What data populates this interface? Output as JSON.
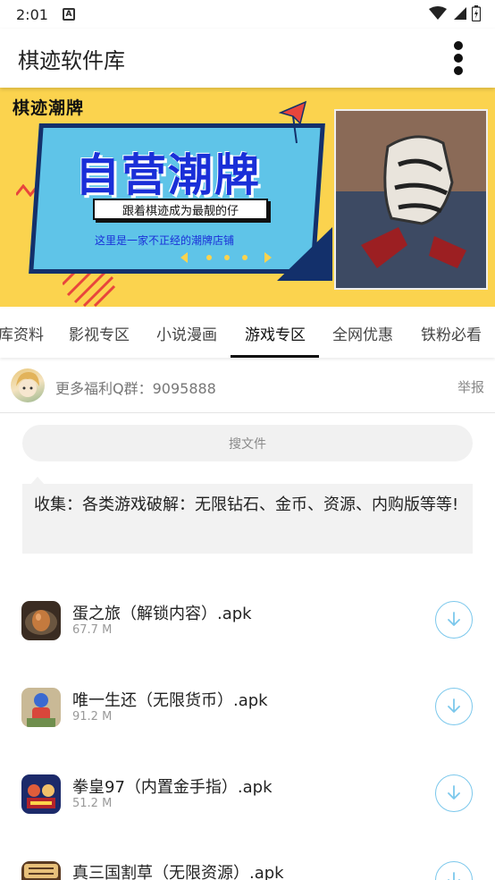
{
  "status_bar": {
    "time": "2:01",
    "notification_icon": "a-icon",
    "icons": [
      "wifi-icon",
      "signal-icon",
      "battery-icon"
    ]
  },
  "app_bar": {
    "title": "棋迹软件库",
    "menu_icon": "more-vertical-icon"
  },
  "banner": {
    "brand": "棋迹潮牌",
    "headline": "自营潮牌",
    "ribbon": "跟着棋迹成为最靓的仔",
    "subline": "这里是一家不正经的潮牌店铺",
    "colors": {
      "background": "#fbd34e",
      "card": "#5fc4e8",
      "headline": "#1a2fd8",
      "accent": "#e8453c"
    }
  },
  "tabs": {
    "items": [
      {
        "label": "库资料"
      },
      {
        "label": "影视专区"
      },
      {
        "label": "小说漫画"
      },
      {
        "label": "游戏专区"
      },
      {
        "label": "全网优惠"
      },
      {
        "label": "铁粉必看"
      }
    ],
    "active": "游戏专区"
  },
  "group": {
    "text": "更多福利Q群：9095888",
    "report": "举报"
  },
  "search": {
    "placeholder": "搜文件"
  },
  "description": {
    "text": "收集：各类游戏破解：无限钻石、金币、资源、内购版等等!"
  },
  "files": [
    {
      "name": "蛋之旅（解锁内容）.apk",
      "size": "67.7 M",
      "icon": "egg-game-icon"
    },
    {
      "name": "唯一生还（无限货币）.apk",
      "size": "91.2 M",
      "icon": "survivor-game-icon"
    },
    {
      "name": "拳皇97（内置金手指）.apk",
      "size": "51.2 M",
      "icon": "kof97-game-icon"
    },
    {
      "name": "真三国割草（无限资源）.apk",
      "size": "",
      "icon": "three-kingdoms-game-icon"
    }
  ],
  "accent_color": "#7cc8ec"
}
